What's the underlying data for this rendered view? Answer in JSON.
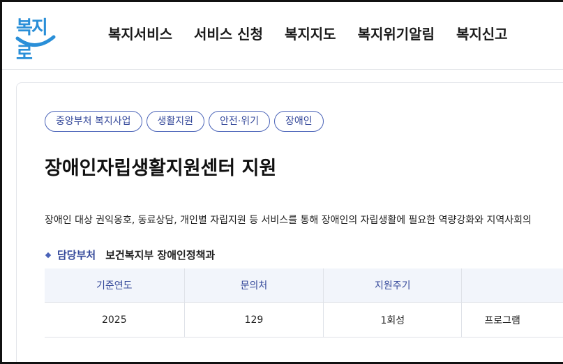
{
  "header": {
    "logo_text": "복지로",
    "nav": [
      "복지서비스",
      "서비스 신청",
      "복지지도",
      "복지위기알림",
      "복지신고"
    ]
  },
  "service": {
    "tags": [
      "중앙부처 복지사업",
      "생활지원",
      "안전·위기",
      "장애인"
    ],
    "title": "장애인자립생활지원센터 지원",
    "description": "장애인 대상 권익옹호, 동료상담, 개인별 자립지원 등 서비스를 통해 장애인의 자립생활에 필요한 역량강화와 지역사회의",
    "dept_label": "담당부처",
    "dept_value": "보건복지부 장애인정책과",
    "table": {
      "headers": [
        "기준연도",
        "문의처",
        "지원주기",
        ""
      ],
      "row": [
        "2025",
        "129",
        "1회성",
        "프로그램"
      ]
    }
  },
  "colors": {
    "accent": "#34489a",
    "logo": "#2a8fd8"
  }
}
